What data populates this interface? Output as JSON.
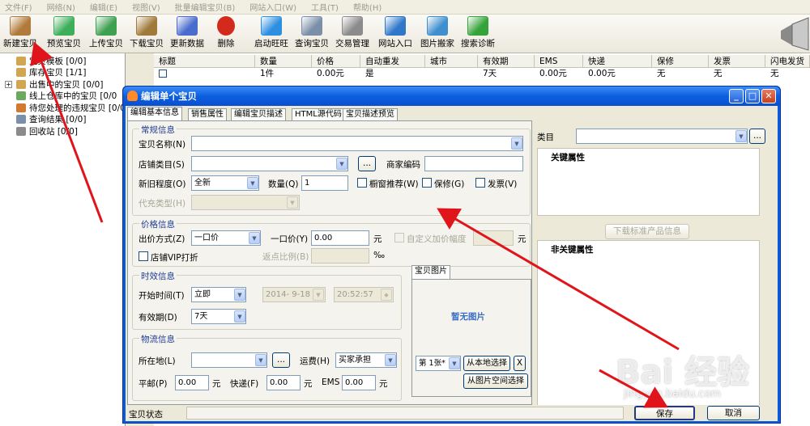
{
  "menubar": [
    "文件(F)",
    "网络(N)",
    "编辑(E)",
    "视图(V)",
    "批量编辑宝贝(B)",
    "网站入口(W)",
    "工具(T)",
    "帮助(H)"
  ],
  "toolbar": [
    {
      "label": "新建宝贝",
      "icon": "box-new-icon",
      "color": "#b07a3a"
    },
    {
      "label": "预览宝贝",
      "icon": "eye-preview-icon",
      "color": "#3fae5a"
    },
    {
      "label": "上传宝贝",
      "icon": "upload-box-icon",
      "color": "#3fa052"
    },
    {
      "label": "下载宝贝",
      "icon": "download-box-icon",
      "color": "#a07a3a"
    },
    {
      "label": "更新数据",
      "icon": "chart-update-icon",
      "color": "#4a6ccc"
    },
    {
      "label": "删除",
      "icon": "delete-x-icon",
      "color": "#d42a1e"
    },
    {
      "label": "启动旺旺",
      "icon": "wangwang-icon",
      "color": "#2d8fe0"
    },
    {
      "label": "查询宝贝",
      "icon": "magnifier-icon",
      "color": "#7b8fa8"
    },
    {
      "label": "交易管理",
      "icon": "gear-icon",
      "color": "#8b8b8b"
    },
    {
      "label": "网站入口",
      "icon": "globe-icon",
      "color": "#2f78c9"
    },
    {
      "label": "图片搬家",
      "icon": "picture-icon",
      "color": "#3f8fcf"
    },
    {
      "label": "搜索诊断",
      "icon": "diagnose-icon",
      "color": "#36a33a"
    }
  ],
  "tree": [
    {
      "label": "宝贝模板   [0/0]",
      "icon": "folder-icon",
      "color": "#d2a550"
    },
    {
      "label": "库存宝贝   [1/1]",
      "icon": "folder-icon",
      "color": "#d2a550"
    },
    {
      "label": "出售中的宝贝  [0/0]",
      "icon": "folder-icon",
      "color": "#d2a550",
      "expander": "+"
    },
    {
      "label": "线上仓库中的宝贝  [0/0",
      "icon": "folder-icon",
      "color": "#6aa95f"
    },
    {
      "label": "待您处理的违规宝贝  [0/0",
      "icon": "warning-folder-icon",
      "color": "#d27a30"
    },
    {
      "label": "查询结果   [0/0]",
      "icon": "search-icon",
      "color": "#7b8fa8"
    },
    {
      "label": "回收站   [0/0]",
      "icon": "trash-icon",
      "color": "#8b8b8b"
    }
  ],
  "grid": {
    "headers": [
      "标题",
      "数量",
      "价格",
      "自动重发",
      "城市",
      "有效期",
      "EMS",
      "快递",
      "保修",
      "发票",
      "闪电发货"
    ],
    "row": [
      "",
      "1件",
      "0.00元",
      "是",
      "",
      "7天",
      "0.00元",
      "0.00元",
      "无",
      "无",
      "无"
    ]
  },
  "dialog": {
    "title": "编辑单个宝贝",
    "tabs": [
      "编辑基本信息",
      "销售属性",
      "编辑宝贝描述",
      "HTML源代码",
      "宝贝描述预览"
    ],
    "basic": {
      "group": "常规信息",
      "name_label": "宝贝名称(N)",
      "name_value": "",
      "shopcat_label": "店铺类目(S)",
      "shopcat_value": "",
      "merchant_code_label": "商家编码",
      "merchant_code_value": "",
      "condition_label": "新旧程度(O)",
      "condition_value": "全新",
      "quantity_label": "数量(Q)",
      "quantity_value": "1",
      "showcase_label": "橱窗推荐(W)",
      "warranty_label": "保修(G)",
      "invoice_label": "发票(V)",
      "recharge_label": "代充类型(H)",
      "recharge_value": "",
      "dots": "..."
    },
    "price": {
      "group": "价格信息",
      "mode_label": "出价方式(Z)",
      "mode_value": "一口价",
      "fixed_label": "一口价(Y)",
      "fixed_value": "0.00",
      "unit": "元",
      "custom_markup_label": "自定义加价幅度",
      "custom_markup_unit": "元",
      "vip_label": "店铺VIP打折",
      "rebate_label": "返点比例(B)",
      "rebate_unit": "%",
      "percent_glyph": "‰"
    },
    "validity": {
      "group": "时效信息",
      "start_label": "开始时间(T)",
      "start_value": "立即",
      "date_value": "2014- 9-18",
      "time_value": "20:52:57",
      "period_label": "有效期(D)",
      "period_value": "7天"
    },
    "logistics": {
      "group": "物流信息",
      "location_label": "所在地(L)",
      "location_value": "",
      "shipping_label": "运费(H)",
      "shipping_value": "买家承担",
      "post_label": "平邮(P)",
      "post_value": "0.00",
      "express_label": "快递(F)",
      "express_value": "0.00",
      "ems_label": "EMS",
      "ems_value": "0.00",
      "unit": "元"
    },
    "picture": {
      "tab": "宝贝图片",
      "empty_text": "暂无图片",
      "index_value": "第 1张*",
      "local_button": "从本地选择",
      "remove_button": "X",
      "space_button": "从图片空间选择"
    },
    "category": {
      "label": "类目",
      "value": "",
      "key_attrs": "关键属性",
      "download_button": "下载标准产品信息",
      "nonkey_attrs": "非关键属性"
    },
    "status_label": "宝贝状态",
    "save_button": "保存",
    "cancel_button": "取消"
  },
  "watermark": {
    "brand": "Bai 经验",
    "url": "jingyan.baidu.com"
  },
  "colors": {
    "arrow": "#e0151b",
    "title_bar": "#0a5cd8",
    "group_title": "#1f3c8f",
    "picture_text": "#3a6fc4"
  }
}
